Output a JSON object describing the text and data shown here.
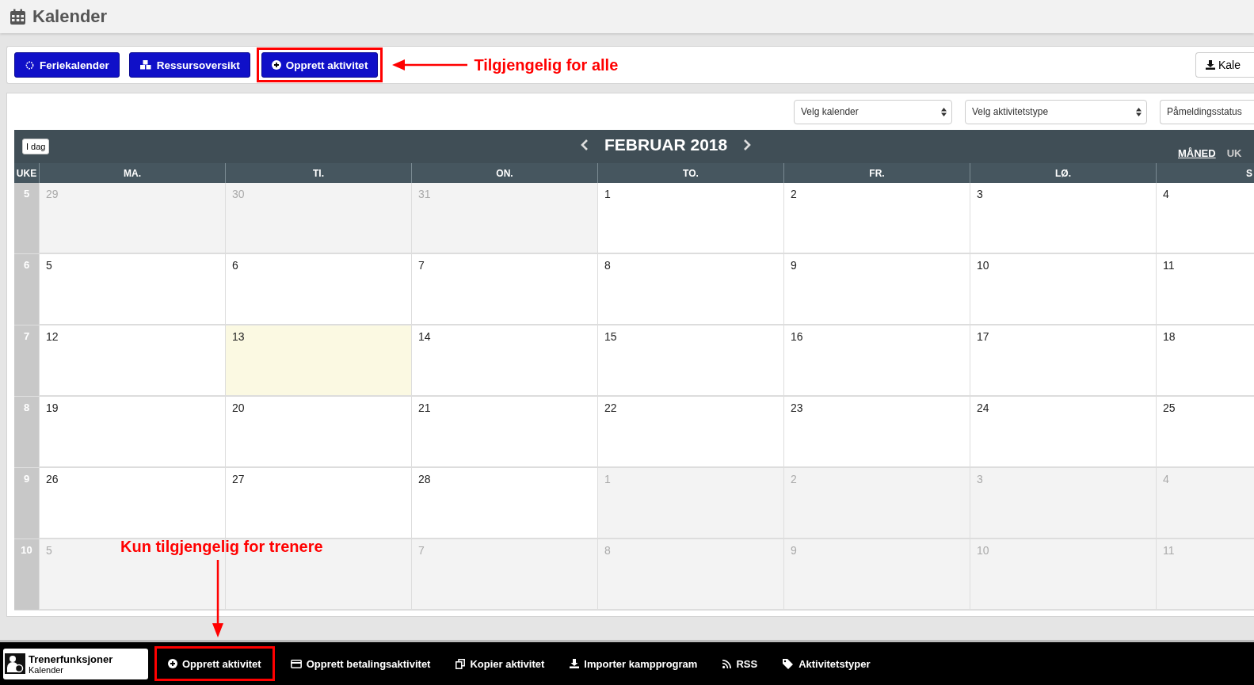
{
  "header": {
    "title": "Kalender"
  },
  "toolbar": {
    "buttons": [
      {
        "label": "Feriekalender",
        "kind": "sun",
        "highlighted": false
      },
      {
        "label": "Ressursoversikt",
        "kind": "cubes",
        "highlighted": false
      },
      {
        "label": "Opprett aktivitet",
        "kind": "plus",
        "highlighted": true
      }
    ],
    "export_button": "Kale"
  },
  "annotations": {
    "top": "Tilgjengelig for alle",
    "bottom": "Kun tilgjengelig for trenere"
  },
  "filters": [
    {
      "value": "Velg kalender"
    },
    {
      "value": "Velg aktivitetstype"
    },
    {
      "value": "Påmeldingsstatus"
    }
  ],
  "calendar": {
    "today_button": "I dag",
    "title": "FEBRUAR 2018",
    "views": [
      {
        "label": "MÅNED",
        "selected": true
      },
      {
        "label": "UK",
        "selected": false
      }
    ],
    "week_header": "UKE",
    "day_headers": [
      "MA.",
      "TI.",
      "ON.",
      "TO.",
      "FR.",
      "LØ.",
      "S"
    ],
    "weeks": [
      {
        "number": "5",
        "days": [
          {
            "day": "29",
            "outside": true,
            "today": false
          },
          {
            "day": "30",
            "outside": true,
            "today": false
          },
          {
            "day": "31",
            "outside": true,
            "today": false
          },
          {
            "day": "1",
            "outside": false,
            "today": false
          },
          {
            "day": "2",
            "outside": false,
            "today": false
          },
          {
            "day": "3",
            "outside": false,
            "today": false
          },
          {
            "day": "4",
            "outside": false,
            "today": false
          }
        ]
      },
      {
        "number": "6",
        "days": [
          {
            "day": "5",
            "outside": false,
            "today": false
          },
          {
            "day": "6",
            "outside": false,
            "today": false
          },
          {
            "day": "7",
            "outside": false,
            "today": false
          },
          {
            "day": "8",
            "outside": false,
            "today": false
          },
          {
            "day": "9",
            "outside": false,
            "today": false
          },
          {
            "day": "10",
            "outside": false,
            "today": false
          },
          {
            "day": "11",
            "outside": false,
            "today": false
          }
        ]
      },
      {
        "number": "7",
        "days": [
          {
            "day": "12",
            "outside": false,
            "today": false
          },
          {
            "day": "13",
            "outside": false,
            "today": true
          },
          {
            "day": "14",
            "outside": false,
            "today": false
          },
          {
            "day": "15",
            "outside": false,
            "today": false
          },
          {
            "day": "16",
            "outside": false,
            "today": false
          },
          {
            "day": "17",
            "outside": false,
            "today": false
          },
          {
            "day": "18",
            "outside": false,
            "today": false
          }
        ]
      },
      {
        "number": "8",
        "days": [
          {
            "day": "19",
            "outside": false,
            "today": false
          },
          {
            "day": "20",
            "outside": false,
            "today": false
          },
          {
            "day": "21",
            "outside": false,
            "today": false
          },
          {
            "day": "22",
            "outside": false,
            "today": false
          },
          {
            "day": "23",
            "outside": false,
            "today": false
          },
          {
            "day": "24",
            "outside": false,
            "today": false
          },
          {
            "day": "25",
            "outside": false,
            "today": false
          }
        ]
      },
      {
        "number": "9",
        "days": [
          {
            "day": "26",
            "outside": false,
            "today": false
          },
          {
            "day": "27",
            "outside": false,
            "today": false
          },
          {
            "day": "28",
            "outside": false,
            "today": false
          },
          {
            "day": "1",
            "outside": true,
            "today": false
          },
          {
            "day": "2",
            "outside": true,
            "today": false
          },
          {
            "day": "3",
            "outside": true,
            "today": false
          },
          {
            "day": "4",
            "outside": true,
            "today": false
          }
        ]
      },
      {
        "number": "10",
        "days": [
          {
            "day": "5",
            "outside": true,
            "today": false
          },
          {
            "outside": true,
            "today": false
          },
          {
            "day": "7",
            "outside": true,
            "today": false
          },
          {
            "day": "8",
            "outside": true,
            "today": false
          },
          {
            "day": "9",
            "outside": true,
            "today": false
          },
          {
            "day": "10",
            "outside": true,
            "today": false
          },
          {
            "day": "11",
            "outside": true,
            "today": false
          }
        ]
      }
    ]
  },
  "bottom_bar": {
    "title": "Trenerfunksjoner",
    "subtitle": "Kalender",
    "items": [
      {
        "label": "Opprett aktivitet",
        "kind": "plus",
        "highlighted": true
      },
      {
        "label": "Opprett betalingsaktivitet",
        "kind": "card",
        "highlighted": false
      },
      {
        "label": "Kopier aktivitet",
        "kind": "copy",
        "highlighted": false
      },
      {
        "label": "Importer kampprogram",
        "kind": "download",
        "highlighted": false
      },
      {
        "label": "RSS",
        "kind": "rss",
        "highlighted": false
      },
      {
        "label": "Aktivitetstyper",
        "kind": "tag",
        "highlighted": false
      }
    ]
  }
}
